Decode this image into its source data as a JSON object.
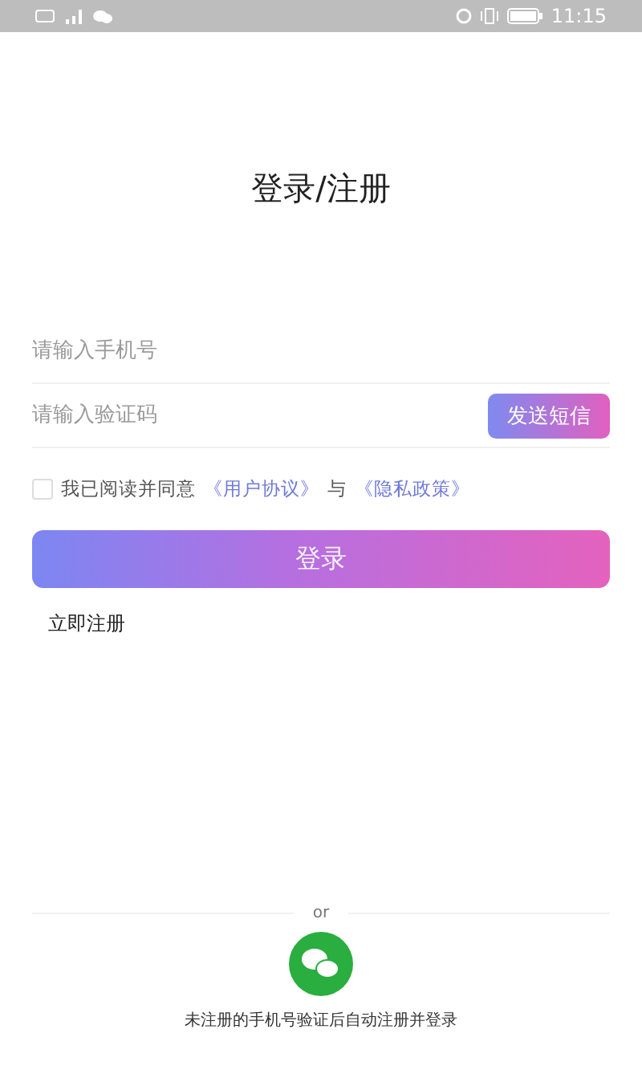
{
  "status_bar": {
    "time": "11:15"
  },
  "title": "登录/注册",
  "fields": [
    {
      "placeholder": "请输入手机号"
    },
    {
      "placeholder": "请输入验证码",
      "action": "发送短信"
    }
  ],
  "agreement": {
    "checked": false,
    "parts": [
      {
        "kind": "text",
        "text": "我已阅读并同意"
      },
      {
        "kind": "link",
        "text": "《用户协议》"
      },
      {
        "kind": "text",
        "text": "与"
      },
      {
        "kind": "link",
        "text": "《隐私政策》"
      }
    ]
  },
  "login_button": "登录",
  "register_link": "立即注册",
  "divider_label": "or",
  "footer_note": "未注册的手机号验证后自动注册并登录"
}
